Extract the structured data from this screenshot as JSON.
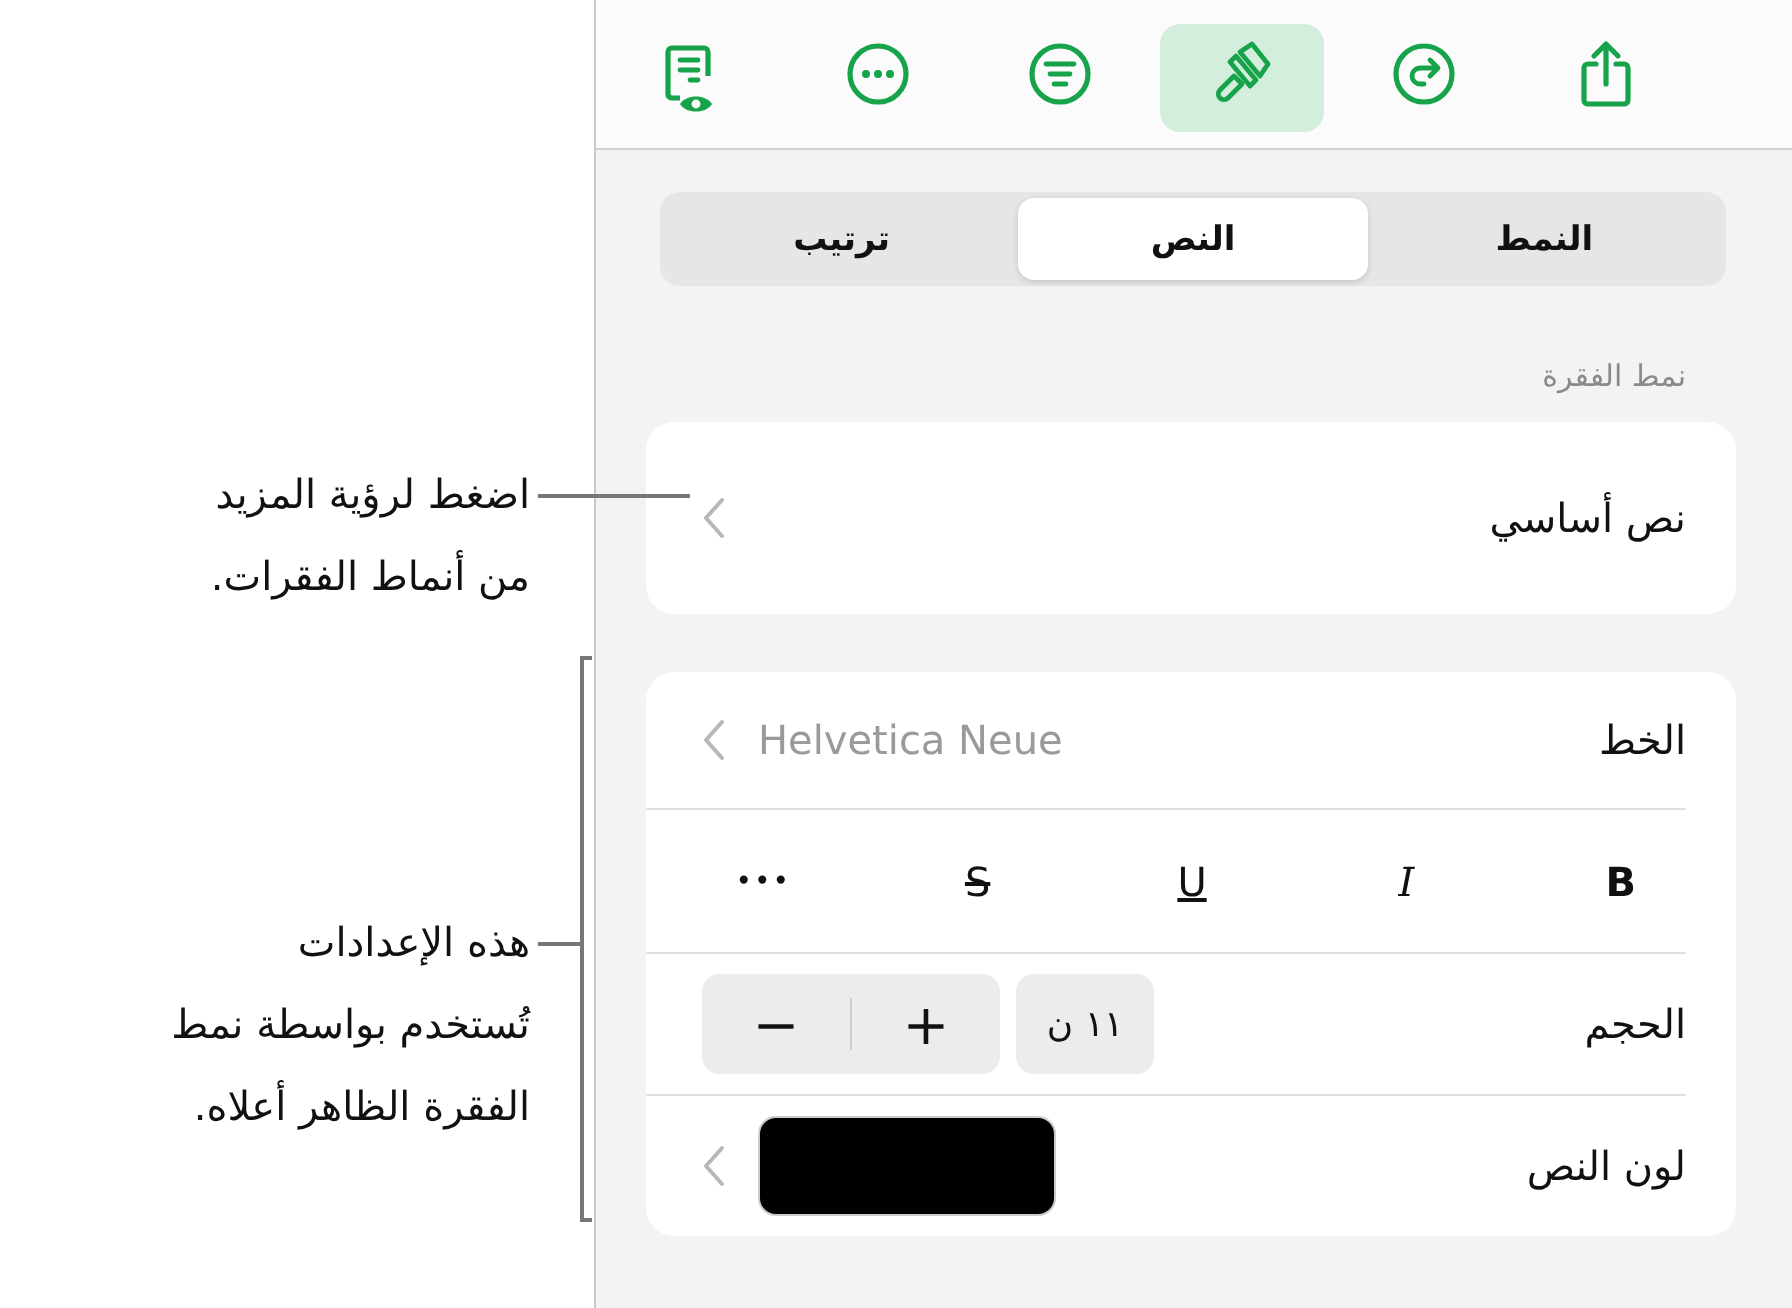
{
  "callouts": [
    {
      "lines": [
        "اضغط لرؤية المزيد",
        "من أنماط الفقرات."
      ],
      "kind": "leader"
    },
    {
      "lines": [
        "هذه الإعدادات",
        "تُستخدم بواسطة نمط",
        "الفقرة الظاهر أعلاه."
      ],
      "kind": "bracket"
    }
  ],
  "toolbar": [
    {
      "kind": "preview",
      "selected": false
    },
    {
      "kind": "more",
      "selected": false
    },
    {
      "kind": "filter",
      "selected": false
    },
    {
      "kind": "brush",
      "selected": true
    },
    {
      "kind": "redo",
      "selected": false
    },
    {
      "kind": "share",
      "selected": false
    }
  ],
  "tabs": [
    {
      "label": "النمط",
      "selected": false
    },
    {
      "label": "النص",
      "selected": true
    },
    {
      "label": "ترتيب",
      "selected": false
    }
  ],
  "paragraph_style": {
    "header": "نمط الفقرة",
    "value": "نص أساسي"
  },
  "font": {
    "label": "الخط",
    "value": "Helvetica Neue"
  },
  "text_styles": [
    {
      "label": "B",
      "kind": "bold"
    },
    {
      "label": "I",
      "kind": "italic"
    },
    {
      "label": "U",
      "kind": "underline"
    },
    {
      "label": "S",
      "kind": "strike"
    },
    {
      "label": "•••",
      "kind": "more"
    }
  ],
  "size": {
    "label": "الحجم",
    "value": "١١ ن",
    "decrease": "−",
    "increase": "+"
  },
  "text_color": {
    "label": "لون النص",
    "color": "#000000"
  }
}
